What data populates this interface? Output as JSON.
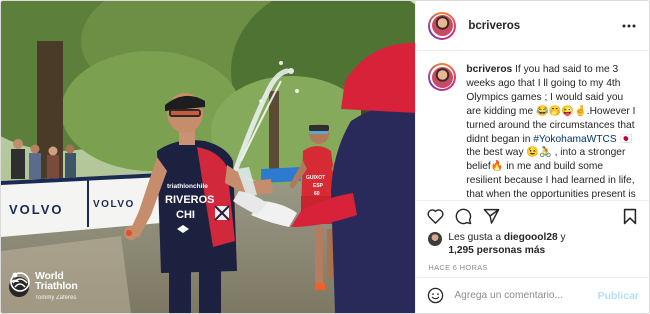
{
  "header": {
    "username": "bcriveros"
  },
  "caption": {
    "username": "bcriveros",
    "text_1": "If you had said to me 3 weeks ago that I ll going to my 4th Olympics games ; I would said you are kidding me 😂🤭😜🤞.However I turned around the circumstances that didnt began in ",
    "hashtag": "#YokohamaWTCS",
    "text_2": " 🇯🇵 the best way 😉🚴 , into a stronger belief🔥 in me and build some resilient because I had learned in life, that when the opportunities present is not time to"
  },
  "photo": {
    "brand_line1": "World",
    "brand_line2": "Triathlon",
    "photographer": "Tommy Zaferes",
    "banner_text": "VOLVO",
    "race_bib_sponsor": "triathlonchile",
    "athlete_name_line1": "RIVEROS",
    "athlete_name_line2": "CHI",
    "runner_bib_name": "GUIXOT",
    "runner_bib_country": "ESP",
    "runner_bib_number": "60",
    "colors": {
      "suit_navy": "#1c2140",
      "suit_red": "#d2283c",
      "volunteer_red": "#d8223a"
    }
  },
  "likes": {
    "prefix": "Les gusta a ",
    "first_user": "diegoool28",
    "connector": " y",
    "count_text": "1,295 personas más"
  },
  "time_ago": "HACE 6 HORAS",
  "comment": {
    "placeholder": "Agrega un comentario...",
    "post_label": "Publicar"
  },
  "icons": {
    "more": "more-horizontal-icon",
    "like": "heart-icon",
    "comment": "comment-bubble-icon",
    "share": "send-paper-plane-icon",
    "save": "bookmark-icon",
    "emoji": "smiley-icon"
  }
}
